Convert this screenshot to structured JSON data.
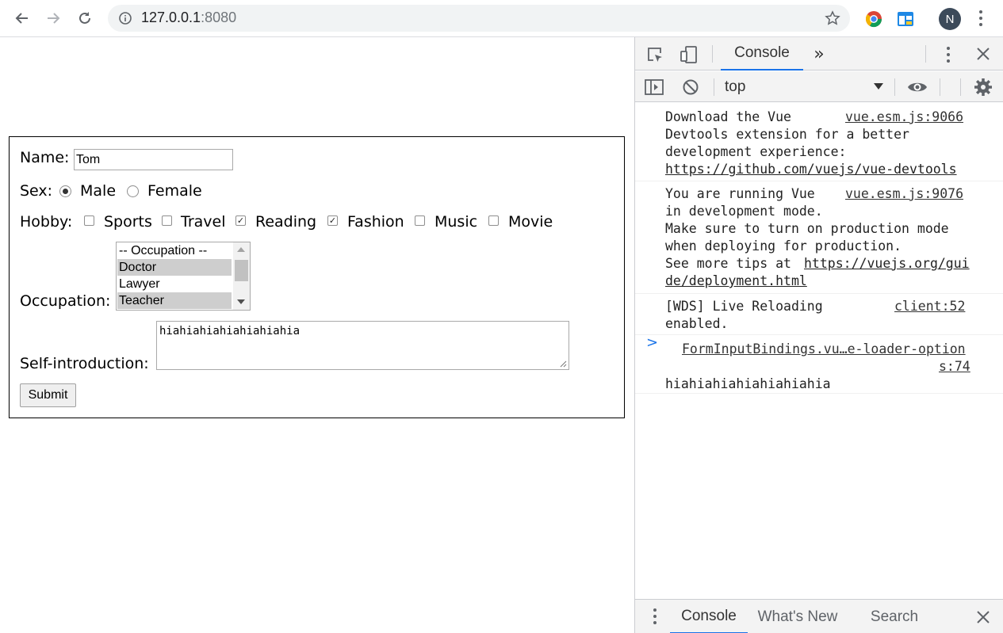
{
  "browser": {
    "url_host": "127.0.0.1",
    "url_port": ":8080",
    "avatar_letter": "N",
    "icons": [
      "back-arrow-icon",
      "forward-arrow-icon",
      "reload-icon",
      "info-icon",
      "star-icon",
      "chrome-extension-icon",
      "app-extension-icon",
      "kebab-menu-icon"
    ]
  },
  "form": {
    "name_label": "Name:",
    "name_value": "Tom",
    "sex_label": "Sex:",
    "sex_options": [
      {
        "label": "Male",
        "checked": true
      },
      {
        "label": "Female",
        "checked": false
      }
    ],
    "hobby_label": "Hobby:",
    "hobbies": [
      {
        "label": "Sports",
        "checked": false
      },
      {
        "label": "Travel",
        "checked": false
      },
      {
        "label": "Reading",
        "checked": true
      },
      {
        "label": "Fashion",
        "checked": true
      },
      {
        "label": "Music",
        "checked": false
      },
      {
        "label": "Movie",
        "checked": false
      }
    ],
    "occupation_label": "Occupation:",
    "occupation_options": [
      {
        "label": "-- Occupation --",
        "selected": false
      },
      {
        "label": "Doctor",
        "selected": true
      },
      {
        "label": "Lawyer",
        "selected": false
      },
      {
        "label": "Teacher",
        "selected": true
      }
    ],
    "intro_label": "Self-introduction:",
    "intro_value": "hiahiahiahiahiahiahia",
    "submit_label": "Submit"
  },
  "devtools": {
    "tab_console": "Console",
    "more_tabs": "»",
    "context": "top",
    "messages": [
      {
        "lines": [
          "Download the Vue",
          "Devtools extension for a better",
          "development experience:",
          "https://github.com/vuejs/vue-devtools"
        ],
        "source": "vue.esm.js:9066"
      },
      {
        "lines": [
          "You are running Vue",
          "in development mode.",
          "Make sure to turn on production mode",
          "when deploying for production.",
          "See more tips at ",
          "https://vuejs.org/gui",
          "de/deployment.html"
        ],
        "source": "vue.esm.js:9076"
      },
      {
        "lines": [
          "[WDS] Live Reloading",
          "enabled."
        ],
        "source": "client:52"
      },
      {
        "source_line1": "FormInputBindings.vu…e-loader-option",
        "source_line2": "s:74",
        "lines": [
          "hiahiahiahiahiahiahia"
        ]
      }
    ],
    "prompt": ">",
    "drawer_tabs": [
      "Console",
      "What's New",
      "Search"
    ]
  }
}
